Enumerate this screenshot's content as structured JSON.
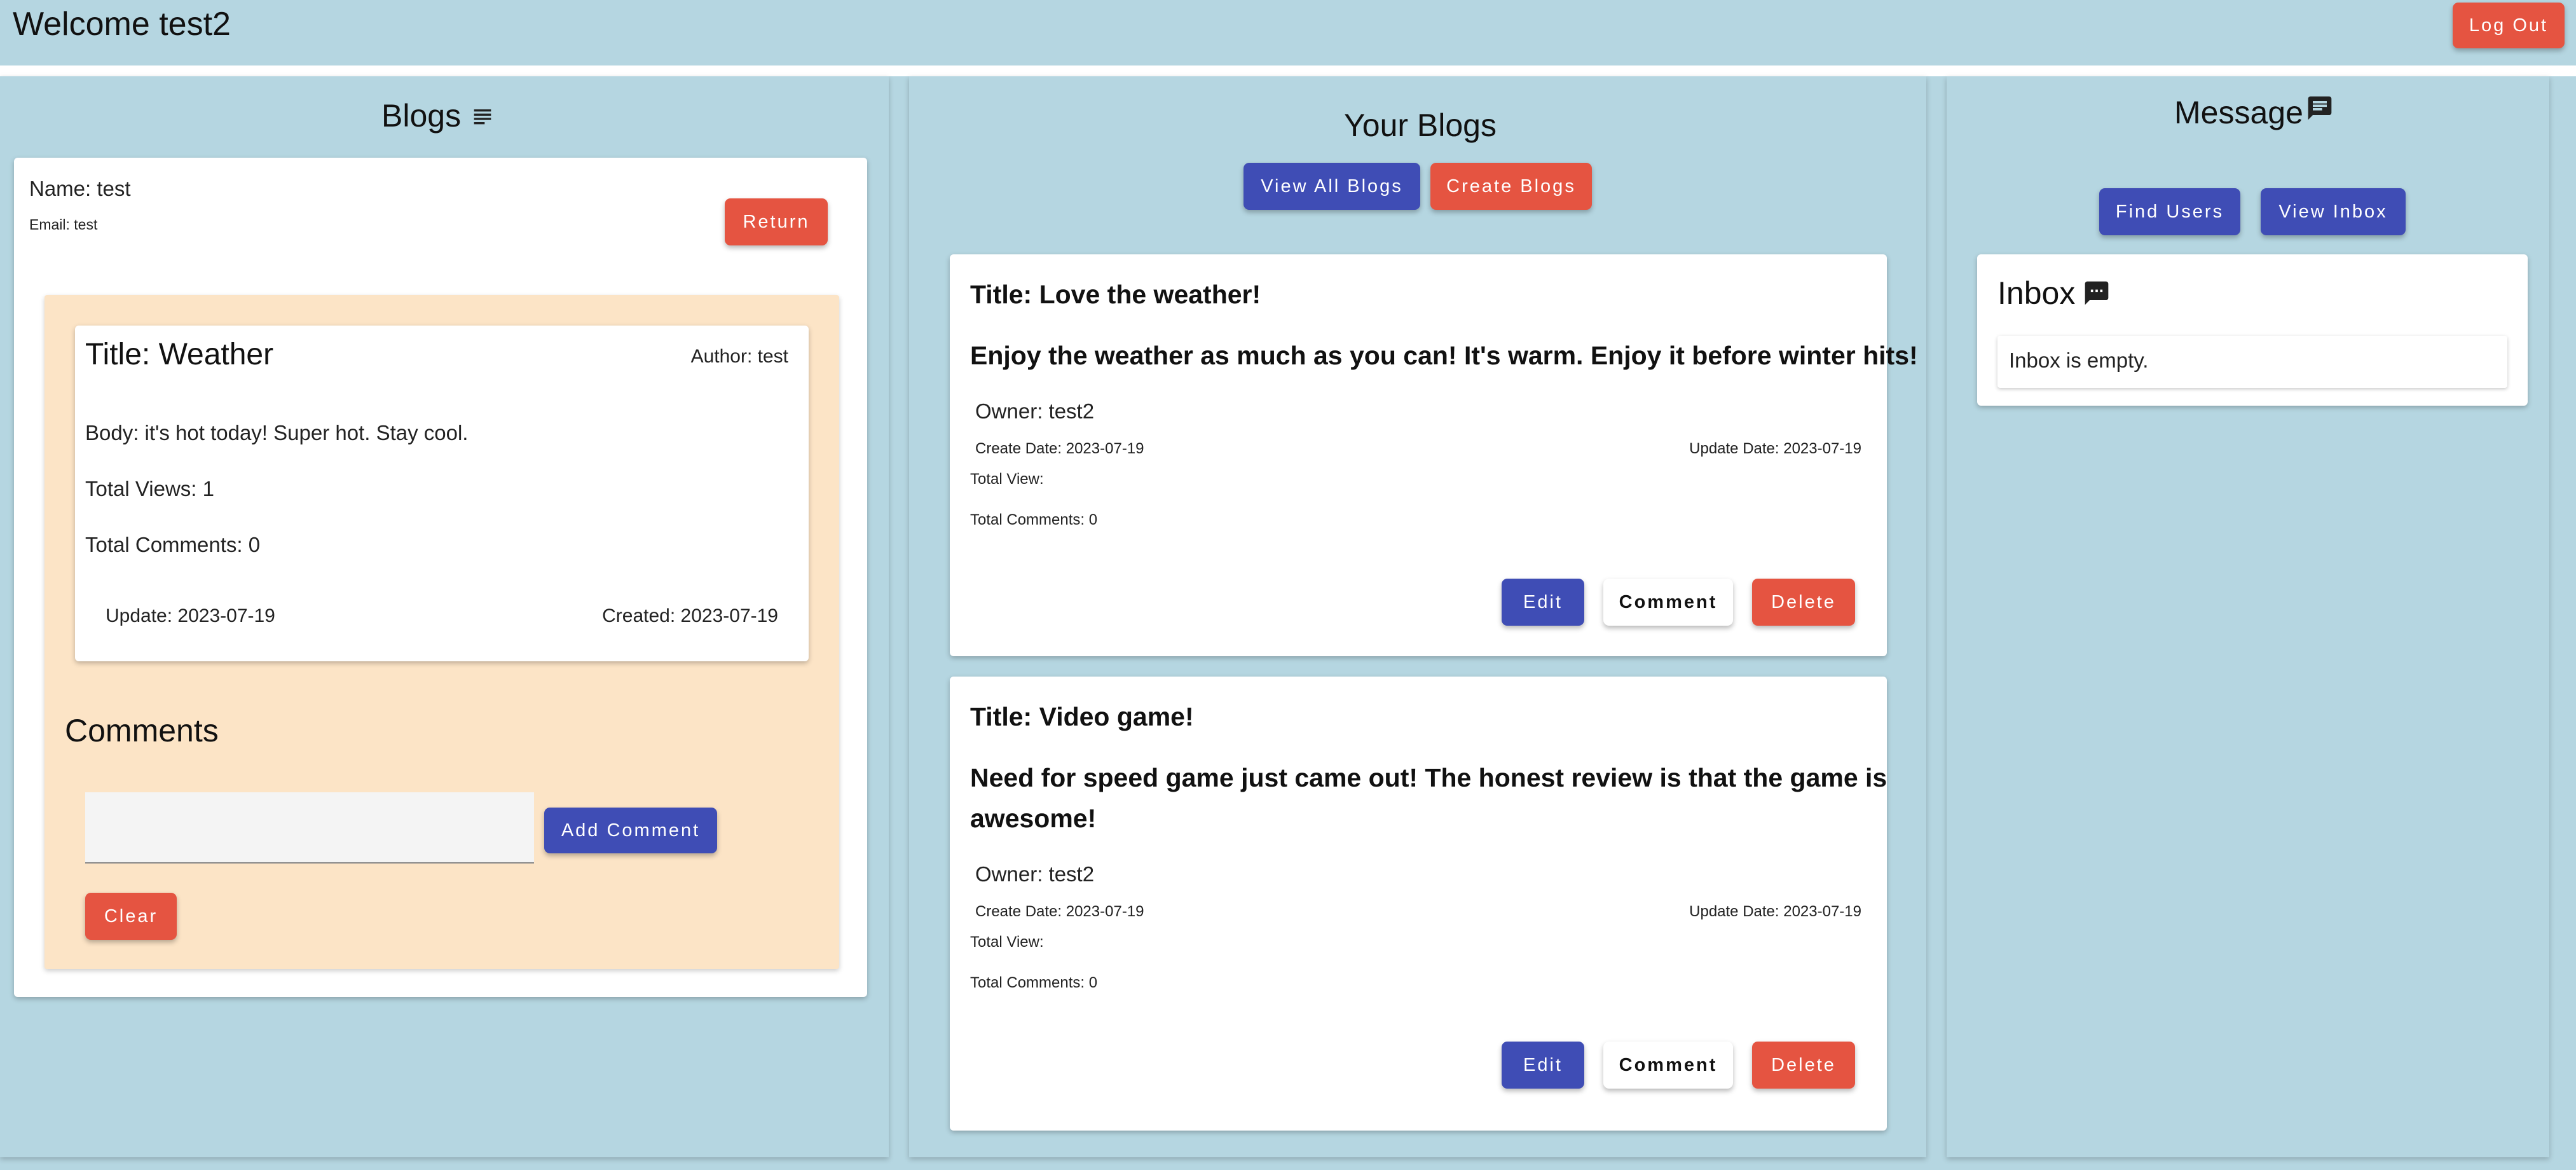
{
  "header": {
    "welcome": "Welcome test2",
    "logout_label": "Log Out"
  },
  "blogs_panel": {
    "title": "Blogs",
    "user": {
      "name": "Name: test",
      "email": "Email: test"
    },
    "return_label": "Return",
    "blog": {
      "title": "Title: Weather",
      "author": "Author: test",
      "body": "Body: it's hot today! Super hot. Stay cool.",
      "views": "Total Views: 1",
      "comments": "Total Comments: 0",
      "updated": "Update: 2023-07-19",
      "created": "Created: 2023-07-19"
    },
    "comments_heading": "Comments",
    "comment_input": {
      "value": "",
      "placeholder": ""
    },
    "add_comment_label": "Add Comment",
    "clear_label": "Clear"
  },
  "your_blogs": {
    "title": "Your Blogs",
    "view_all_label": "View All Blogs",
    "create_label": "Create Blogs",
    "posts": [
      {
        "title": "Title: Love the weather!",
        "body": "Enjoy the weather as much as you can! It's warm. Enjoy it before winter hits!",
        "owner": "Owner: test2",
        "create_date": "Create Date: 2023-07-19",
        "update_date": "Update Date: 2023-07-19",
        "total_view": "Total View:",
        "total_comments": "Total Comments: 0",
        "edit_label": "Edit",
        "comment_label": "Comment",
        "delete_label": "Delete"
      },
      {
        "title": "Title: Video game!",
        "body_line1": "Need for speed game just came out! The honest review is that the game is",
        "body_line2": "awesome!",
        "owner": "Owner: test2",
        "create_date": "Create Date: 2023-07-19",
        "update_date": "Update Date: 2023-07-19",
        "total_view": "Total View:",
        "total_comments": "Total Comments: 0",
        "edit_label": "Edit",
        "comment_label": "Comment",
        "delete_label": "Delete"
      }
    ]
  },
  "message_panel": {
    "title": "Message",
    "find_users_label": "Find Users",
    "view_inbox_label": "View Inbox",
    "inbox_title": "Inbox",
    "inbox_empty": "Inbox is empty."
  },
  "icons": {
    "blogs": "subject-lines-icon",
    "message": "chat-bubble-icon",
    "inbox": "chat-dots-icon"
  },
  "colors": {
    "background": "#b5d6e1",
    "red_button": "#e55441",
    "blue_button": "#3f4db5",
    "peach_panel": "#fce4c6",
    "input_fill": "#f4f4f4"
  }
}
